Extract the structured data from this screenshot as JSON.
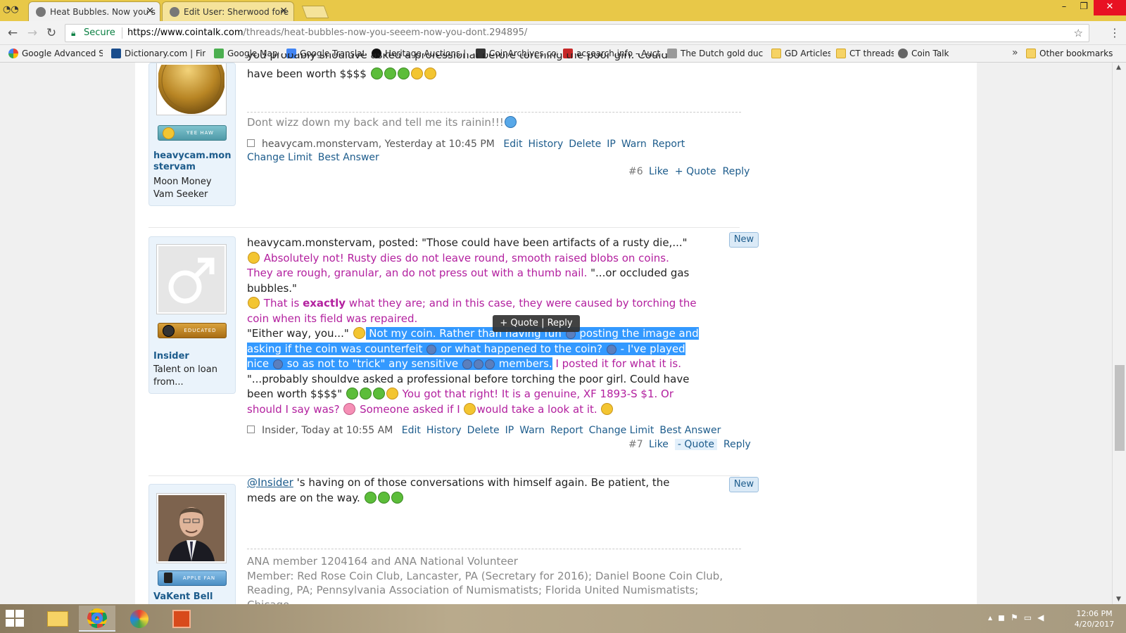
{
  "browser": {
    "tabs": [
      {
        "title": "Heat Bubbles. Now you s",
        "active": true
      },
      {
        "title": "Edit User: Sherwood fore",
        "active": false
      }
    ],
    "secure_label": "Secure",
    "url_host": "https://www.cointalk.com",
    "url_path": "/threads/heat-bubbles-now-you-seeem-now-you-dont.294895/",
    "bookmarks": [
      {
        "label": "Google Advanced Sea",
        "icon": "google-icon"
      },
      {
        "label": "Dictionary.com | Find",
        "icon": "dictionary-icon"
      },
      {
        "label": "Google Maps",
        "icon": "maps-icon"
      },
      {
        "label": "Google Translate",
        "icon": "translate-icon"
      },
      {
        "label": "Heritage Auctions | W",
        "icon": "heritage-icon"
      },
      {
        "label": "CoinArchives.com",
        "icon": "coinarchives-icon"
      },
      {
        "label": "acsearch.info - Auctio",
        "icon": "acsearch-icon"
      },
      {
        "label": "The Dutch gold ducat",
        "icon": "ducat-icon"
      },
      {
        "label": "GD Articles",
        "icon": "folder-icon"
      },
      {
        "label": "CT threads",
        "icon": "folder-icon"
      },
      {
        "label": "Coin Talk",
        "icon": "cointalk-icon"
      }
    ],
    "bookmarks_more": "»",
    "other_bookmarks": "Other bookmarks"
  },
  "posts": [
    {
      "partial_top_line": "you probably shouldve asked a professional before torching the poor girl. Could",
      "partial_second_line": "have been worth $$$$",
      "signature": "Dont wizz down my back and tell me its rainin!!!",
      "meta_author": "heavycam.monstervam",
      "meta_time": "Yesterday at 10:45 PM",
      "meta_links": [
        "Edit",
        "History",
        "Delete",
        "IP",
        "Warn",
        "Report"
      ],
      "meta_links_2": [
        "Change Limit",
        "Best Answer"
      ],
      "number": "#6",
      "actions": [
        "Like",
        "+ Quote",
        "Reply"
      ],
      "user": {
        "name_line1": "heavycam.mon",
        "name_line2": "stervam",
        "title_line1": "Moon Money",
        "title_line2": "Vam Seeker",
        "badge": "YEE HAW"
      }
    },
    {
      "new_label": "New",
      "line1": "heavycam.monstervam, posted: \"Those could have been artifacts of a rusty die,...\"",
      "line2_pink": "Absolutely not! Rusty dies do not leave round, smooth raised blobs on coins.",
      "line3_pink": "They are rough, granular, an do not press out with a thumb nail.",
      "line3_black": "\"...or occluded gas",
      "line4": "bubbles.\"",
      "line5_pink_a": "That is",
      "line5_bold": "exactly",
      "line5_pink_b": "what they are; and in this case, they were caused by torching the",
      "line6_pink": "coin when its field was repaired.",
      "line7_black": "\"Either way, you...\"",
      "line7_sel": "Not my coin. Rather than having fun",
      "line7_sel_b": "posting the image and",
      "line8_sel_a": "asking if the coin was counterfeit",
      "line8_sel_b": "or what happened to the coin?",
      "line8_sel_c": "- I've played",
      "line9_sel_a": "nice",
      "line9_sel_b": "so as not to \"trick\" any sensitive",
      "line9_sel_c": "members.",
      "line9_pink": "I posted it for what it is.",
      "line10": "\"...probably shouldve asked a professional before torching the poor girl. Could have",
      "line11_black": "been worth $$$$\"",
      "line11_pink": "You got that right! It is a genuine, XF 1893-S $1. Or",
      "line12_pink_a": "should I say was?",
      "line12_pink_b": "Someone asked if I",
      "line12_pink_c": "would take a look at it.",
      "tooltip_quote": "+ Quote",
      "tooltip_sep": "|",
      "tooltip_reply": "Reply",
      "meta_author": "Insider",
      "meta_time": "Today at 10:55 AM",
      "meta_links": [
        "Edit",
        "History",
        "Delete",
        "IP",
        "Warn",
        "Report",
        "Change Limit",
        "Best Answer"
      ],
      "number": "#7",
      "actions": [
        "Like",
        "- Quote",
        "Reply"
      ],
      "user": {
        "name": "Insider",
        "title_line1": "Talent on loan",
        "title_line2": "from...",
        "badge": "EDUCATED"
      }
    },
    {
      "new_label": "New",
      "mention": "@Insider",
      "line1": "'s having on of those conversations with himself again. Be patient, the",
      "line2": "meds are on the way.",
      "sig_line1": "ANA member 1204164 and ANA National Volunteer",
      "sig_line2": "Member: Red Rose Coin Club, Lancaster, PA (Secretary for 2016); Daniel Boone Coin Club,",
      "sig_line3": "Reading, PA; Pennsylvania Association of Numismatists; Florida United Numismatists; Chicago",
      "user": {
        "name": "VaKent Bell",
        "badge": "APPLE FAN"
      }
    }
  ],
  "taskbar": {
    "time": "12:06 PM",
    "date": "4/20/2017"
  },
  "colors": {
    "accent_link": "#1d5c8c",
    "quote_pink": "#b3219f",
    "selection": "#3399ff",
    "tabstrip": "#e8c848"
  }
}
